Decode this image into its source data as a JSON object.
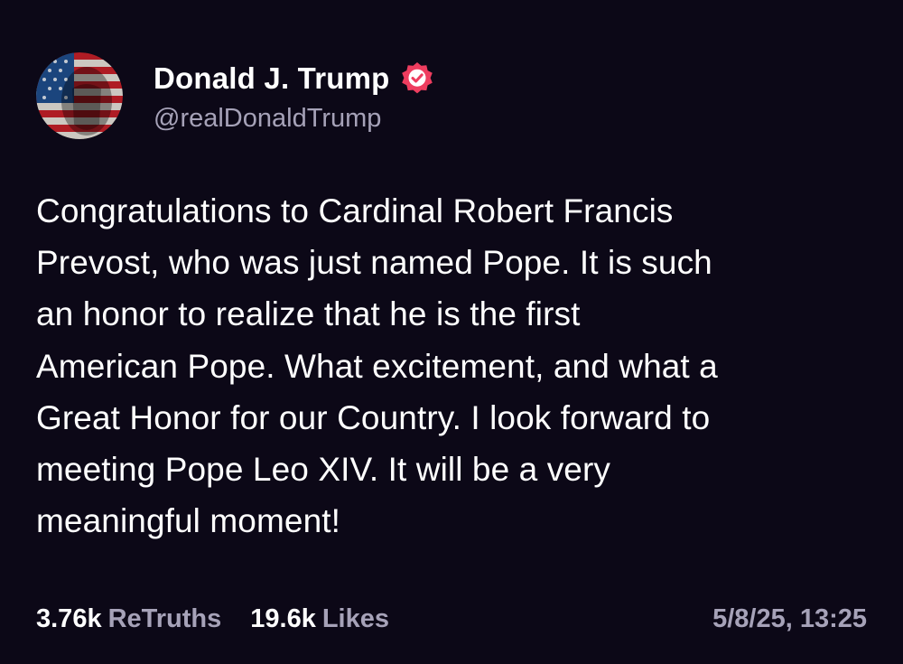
{
  "author": {
    "display_name": "Donald J. Trump",
    "handle": "@realDonaldTrump",
    "avatar_icon": "flag-portrait-avatar",
    "verified_icon": "verified-badge-icon"
  },
  "post": {
    "lines": [
      "Congratulations to Cardinal Robert Francis",
      "Prevost, who was just named Pope. It is such",
      "an honor to realize that he is the first",
      "American Pope. What excitement, and what a",
      "Great Honor for our Country. I look forward to",
      "meeting Pope Leo XIV. It will be a very",
      "meaningful moment!"
    ]
  },
  "stats": {
    "retruths_value": "3.76k",
    "retruths_label": "ReTruths",
    "likes_value": "19.6k",
    "likes_label": "Likes",
    "timestamp": "5/8/25, 13:25"
  },
  "colors": {
    "background": "#0c0817",
    "text_primary": "#ffffff",
    "text_secondary": "#a6a2b8",
    "verified_badge": "#ee3d5f"
  }
}
